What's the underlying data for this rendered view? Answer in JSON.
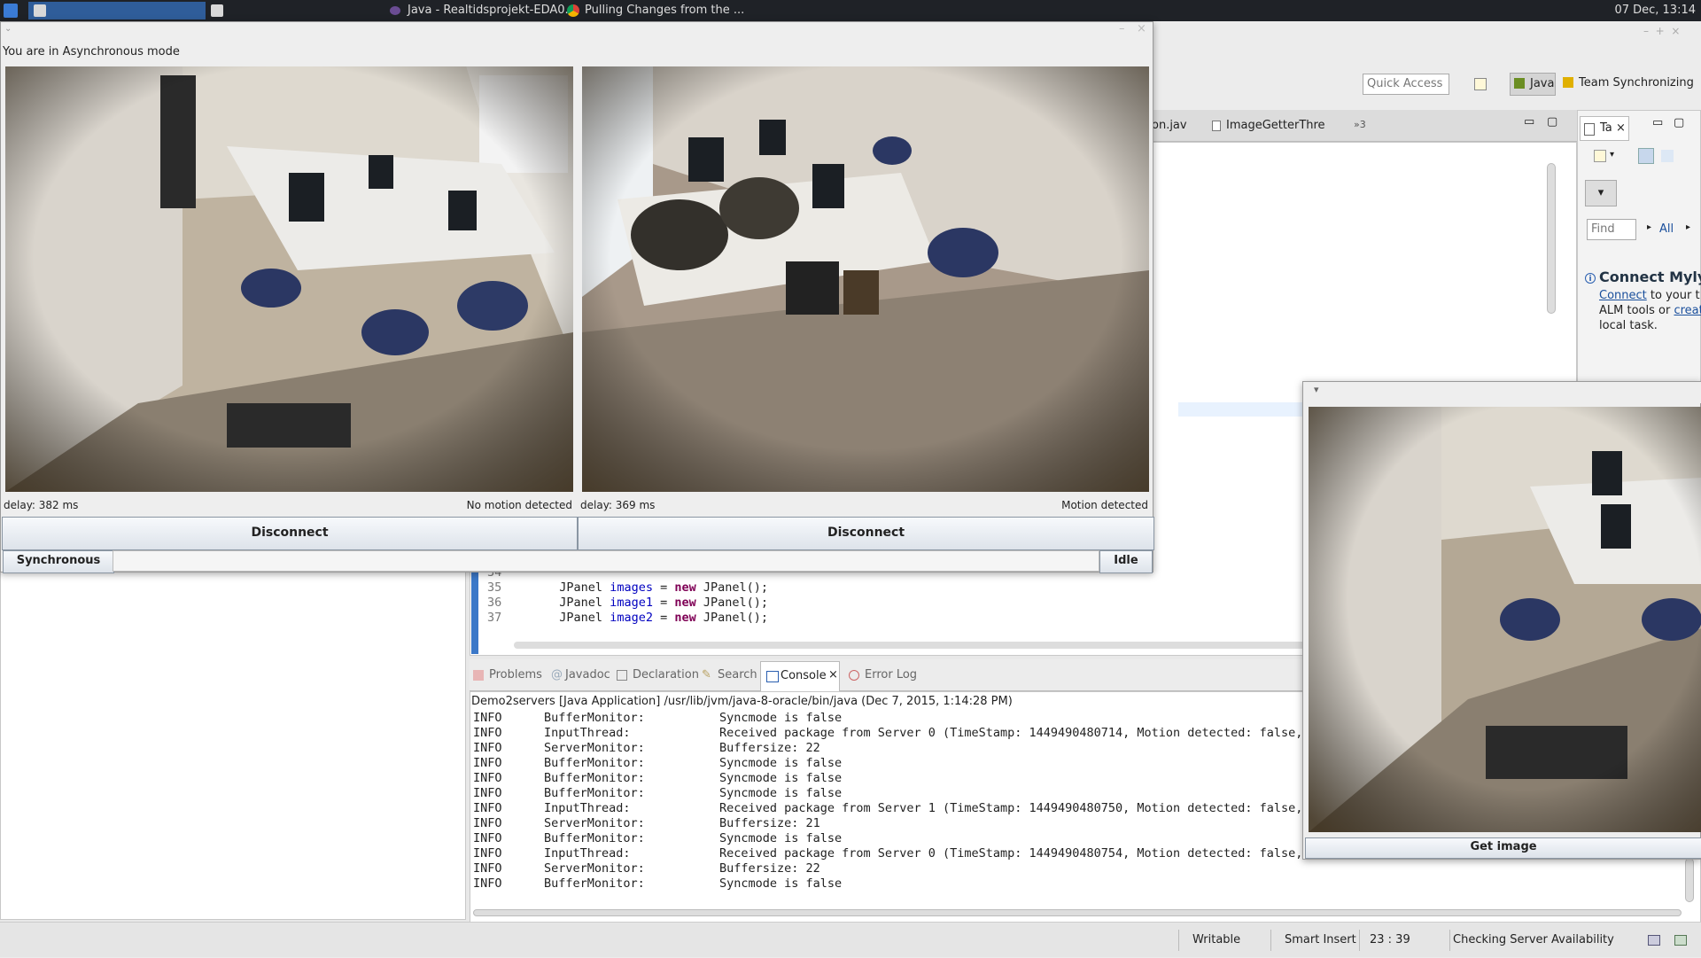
{
  "taskbar": {
    "items": [
      {
        "label": "Java - Realtidsprojekt-EDA0..."
      },
      {
        "label": "Pulling Changes from the ..."
      }
    ],
    "clock": "07 Dec, 13:14"
  },
  "eclipse": {
    "quick_access_placeholder": "Quick Access",
    "perspectives": {
      "java": "Java",
      "team": "Team Synchronizing"
    },
    "editor_tabs": [
      {
        "label": "on.jav"
      },
      {
        "label": "ImageGetterThre"
      },
      {
        "label": "»3"
      }
    ],
    "task_list": {
      "tab_label": "Ta",
      "find_placeholder": "Find",
      "all_label": "All"
    },
    "mylyn": {
      "title": "Connect Myly",
      "link1": "Connect",
      "text1": "to your t",
      "text2": "ALM tools or",
      "link2": "creat",
      "text3": "local task."
    },
    "code_lines": [
      {
        "num": "34",
        "pre": "",
        "kw": "",
        "post": ""
      },
      {
        "num": "35",
        "pre": "        JPanel ",
        "field": "images",
        "mid": " = ",
        "kw": "new",
        "post": " JPanel();"
      },
      {
        "num": "36",
        "pre": "        JPanel ",
        "field": "image1",
        "mid": " = ",
        "kw": "new",
        "post": " JPanel();"
      },
      {
        "num": "37",
        "pre": "        JPanel ",
        "field": "image2",
        "mid": " = ",
        "kw": "new",
        "post": " JPanel();"
      }
    ],
    "bottom_tabs": [
      {
        "label": "Problems"
      },
      {
        "label": "Javadoc"
      },
      {
        "label": "Declaration"
      },
      {
        "label": "Search"
      },
      {
        "label": "Console"
      },
      {
        "label": "Error Log"
      }
    ],
    "console_header": "Demo2servers [Java Application] /usr/lib/jvm/java-8-oracle/bin/java (Dec 7, 2015, 1:14:28 PM)",
    "console_lines": [
      {
        "level": "INFO",
        "source": "BufferMonitor:",
        "message": "Syncmode is false"
      },
      {
        "level": "INFO",
        "source": "InputThread:",
        "message": "Received package from Server 0 (TimeStamp: 1449490480714, Motion detected: false,"
      },
      {
        "level": "INFO",
        "source": "ServerMonitor:",
        "message": "Buffersize: 22"
      },
      {
        "level": "INFO",
        "source": "BufferMonitor:",
        "message": "Syncmode is false"
      },
      {
        "level": "INFO",
        "source": "BufferMonitor:",
        "message": "Syncmode is false"
      },
      {
        "level": "INFO",
        "source": "BufferMonitor:",
        "message": "Syncmode is false"
      },
      {
        "level": "INFO",
        "source": "InputThread:",
        "message": "Received package from Server 1 (TimeStamp: 1449490480750, Motion detected: false,"
      },
      {
        "level": "INFO",
        "source": "ServerMonitor:",
        "message": "Buffersize: 21"
      },
      {
        "level": "INFO",
        "source": "BufferMonitor:",
        "message": "Syncmode is false"
      },
      {
        "level": "INFO",
        "source": "InputThread:",
        "message": "Received package from Server 0 (TimeStamp: 1449490480754, Motion detected: false,"
      },
      {
        "level": "INFO",
        "source": "ServerMonitor:",
        "message": "Buffersize: 22"
      },
      {
        "level": "INFO",
        "source": "BufferMonitor:",
        "message": "Syncmode is false"
      }
    ],
    "status": {
      "writable": "Writable",
      "insert_mode": "Smart Insert",
      "position": "23 : 39",
      "job": "Checking Server Availability"
    }
  },
  "main_window": {
    "mode_text": "You are in Asynchronous mode",
    "cameras": [
      {
        "delay": "delay: 382 ms",
        "motion": "No motion detected",
        "disconnect": "Disconnect"
      },
      {
        "delay": "delay: 369 ms",
        "motion": "Motion detected",
        "disconnect": "Disconnect"
      }
    ],
    "sync_button": "Synchronous",
    "state_label": "Idle"
  },
  "image_window": {
    "get_image_button": "Get image"
  }
}
